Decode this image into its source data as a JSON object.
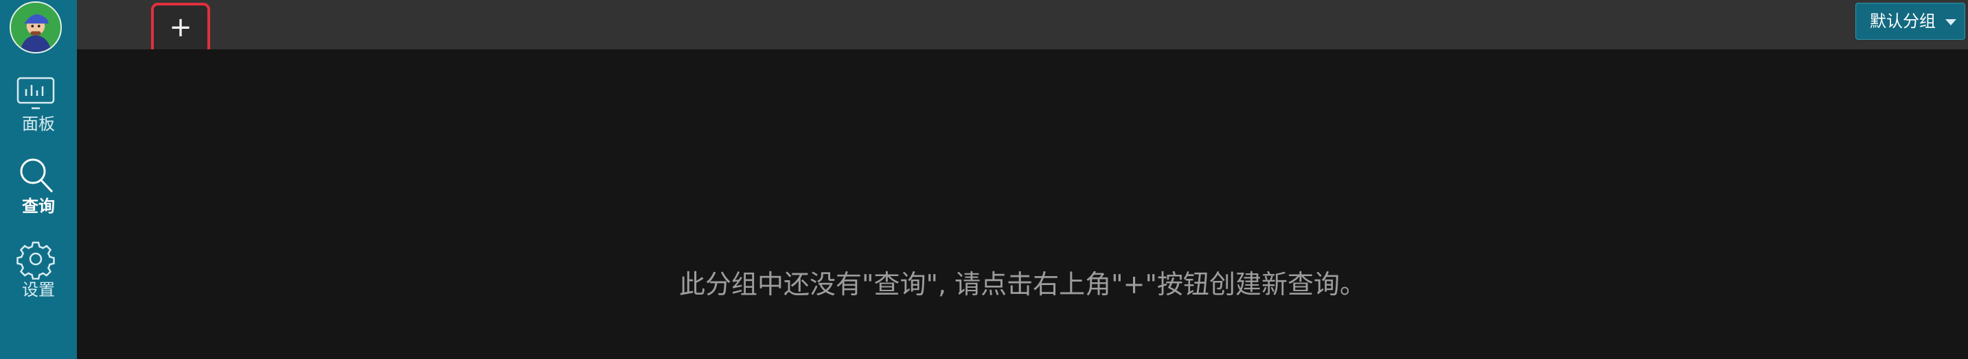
{
  "sidebar": {
    "avatar_icon": "user-avatar-icon",
    "items": [
      {
        "label": "面板",
        "icon": "dashboard-icon",
        "active": false
      },
      {
        "label": "查询",
        "icon": "search-icon",
        "active": true
      },
      {
        "label": "设置",
        "icon": "gear-icon",
        "active": false
      }
    ]
  },
  "topbar": {
    "add_tab_label": "+",
    "group_select_value": "默认分组"
  },
  "main": {
    "empty_message": "此分组中还没有\"查询\", 请点击右上角\"+\"按钮创建新查询。"
  },
  "colors": {
    "sidebar_bg": "#106f88",
    "topbar_bg": "#333333",
    "main_bg": "#151515",
    "highlight_border": "#e0303d",
    "select_bg": "#136a80"
  }
}
